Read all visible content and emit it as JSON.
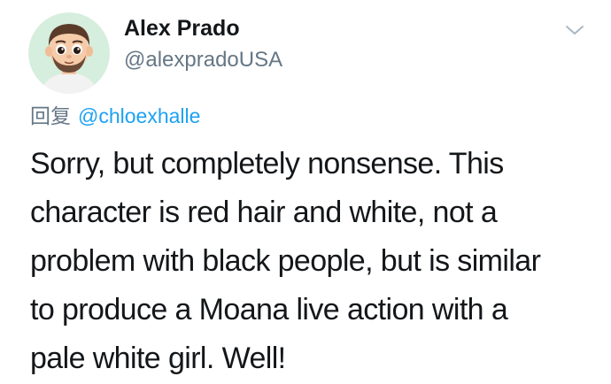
{
  "user": {
    "display_name": "Alex Prado",
    "handle": "@alexpradoUSA",
    "avatar": "cartoon-avatar-icon"
  },
  "menu": {
    "icon": "chevron-down-icon"
  },
  "reply": {
    "prefix": "回复",
    "mention": "@chloexhalle"
  },
  "tweet": {
    "lines": [
      "Sorry, but completely nonsense. This",
      "character is red hair and white, not a",
      "problem with black people, but is similar",
      "to produce a Moana live action with a",
      "pale white girl. Well!"
    ]
  },
  "colors": {
    "accent": "#1da1f2",
    "secondary_text": "#657786",
    "primary_text": "#14171a",
    "avatar_background": "#d6eedd"
  }
}
